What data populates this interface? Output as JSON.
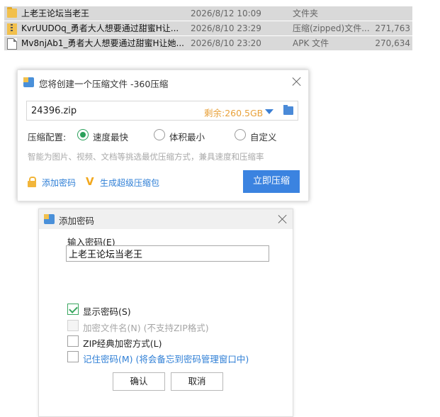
{
  "files": [
    {
      "icon": "folder-icon",
      "name": "上老王论坛当老王",
      "date": "2026/8/12 10:09",
      "type": "文件夹",
      "size": ""
    },
    {
      "icon": "zip-file-icon",
      "name": "KvrUUDOq_勇者大人想要通过甜蜜H让...",
      "date": "2026/8/10 23:29",
      "type": "压缩(zipped)文件...",
      "size": "271,763"
    },
    {
      "icon": "file-icon",
      "name": "Mv8njAb1_勇者大人想要通过甜蜜H让她...",
      "date": "2026/8/10 23:20",
      "type": "APK 文件",
      "size": "270,634"
    }
  ],
  "compress_dialog": {
    "title": "您将创建一个压缩文件 -360压缩",
    "filename": "24396.zip",
    "free_space": "剩余:260.5GB",
    "options_label": "压缩配置:",
    "options": [
      "速度最快",
      "体积最小",
      "自定义"
    ],
    "selected_option": "速度最快",
    "hint": "智能为图片、视频、文档等挑选最优压缩方式，兼具速度和压缩率",
    "add_password_link": "添加密码",
    "super_package_link": "生成超级压缩包",
    "compress_button": "立即压缩",
    "accent_color": "#3b83e0"
  },
  "password_dialog": {
    "title": "添加密码",
    "input_label": "输入密码(E)",
    "password_value": "上老王论坛当老王",
    "checkboxes": [
      {
        "label": "显示密码(S)",
        "checked": true,
        "enabled": true
      },
      {
        "label": "加密文件名(N) (不支持ZIP格式)",
        "checked": false,
        "enabled": false
      },
      {
        "label": "ZIP经典加密方式(L)",
        "checked": false,
        "enabled": true
      },
      {
        "label": "记住密码(M) (将会备忘到密码管理窗口中)",
        "checked": false,
        "enabled": true
      }
    ],
    "ok_button": "确认",
    "cancel_button": "取消"
  }
}
